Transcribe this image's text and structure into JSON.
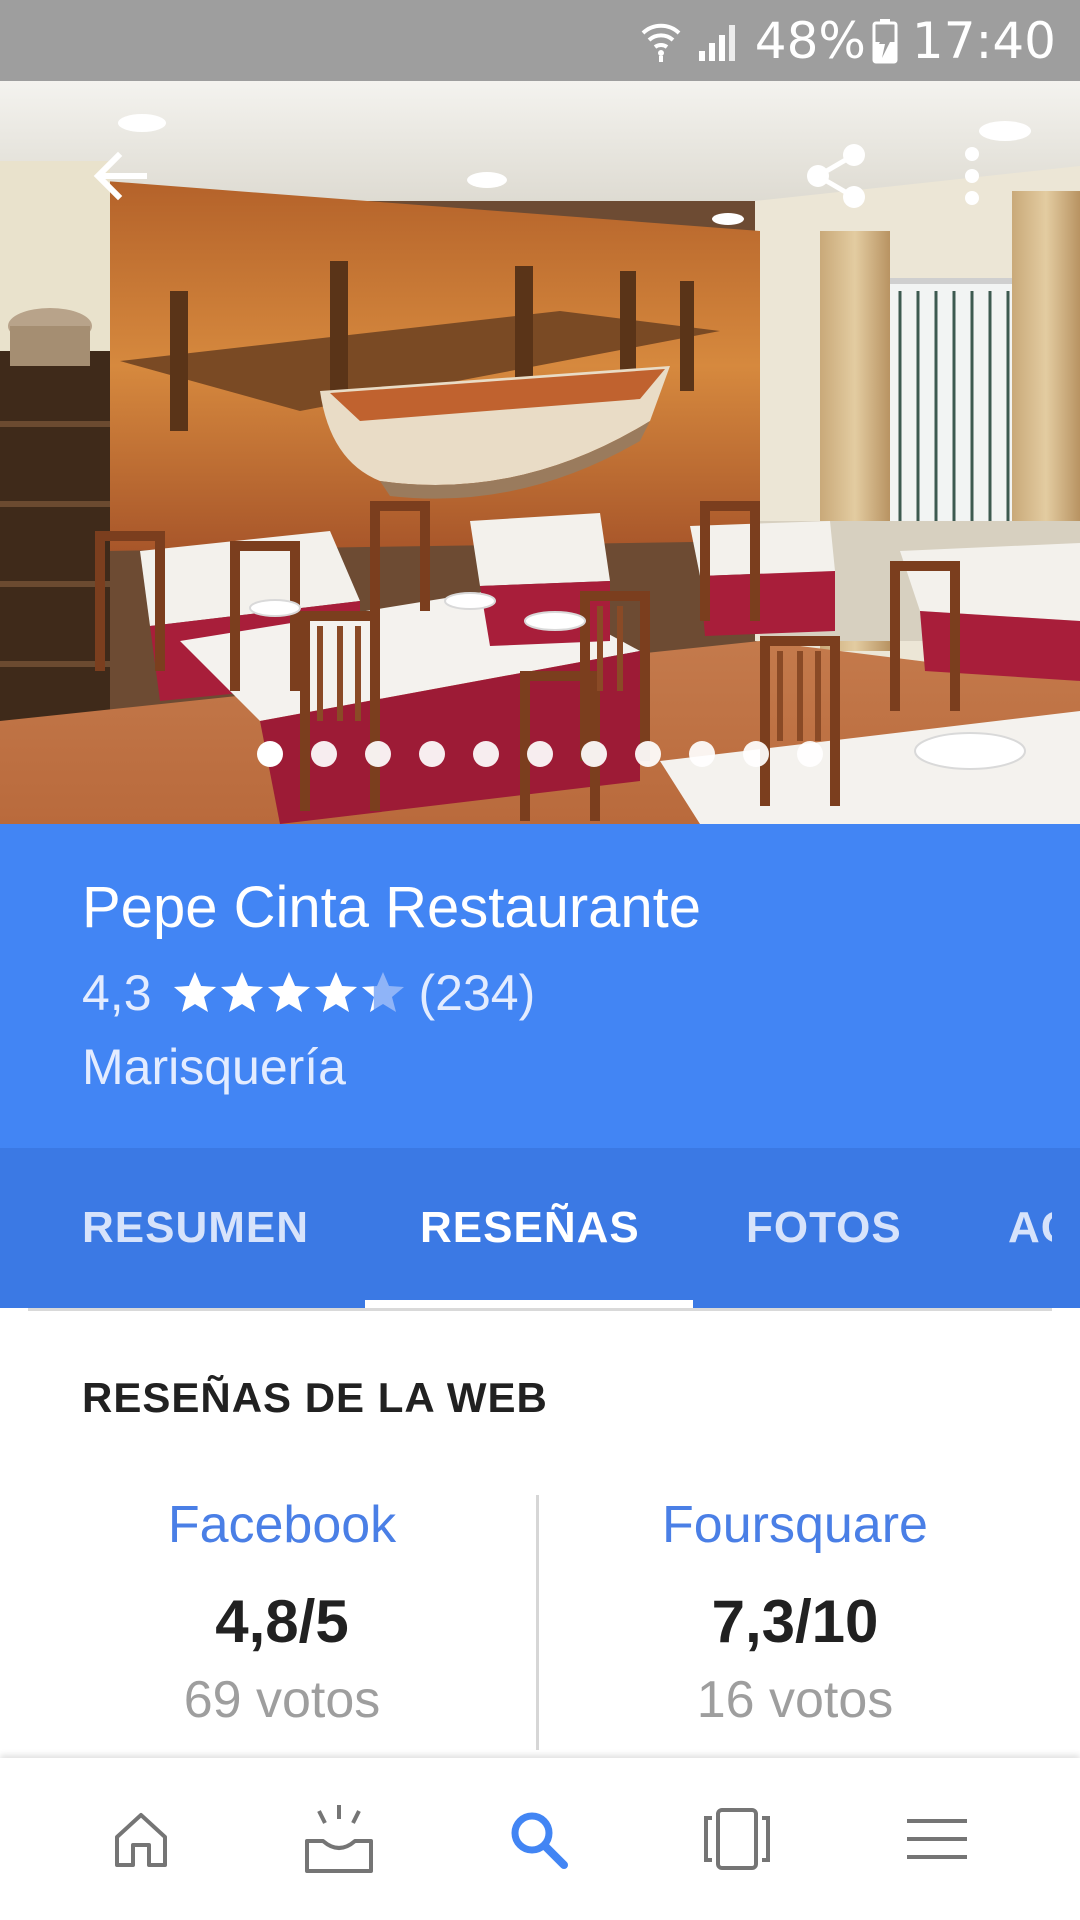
{
  "status_bar": {
    "battery": "48%",
    "time": "17:40",
    "icons": [
      "wifi-icon",
      "signal-icon",
      "battery-charging-icon"
    ]
  },
  "hero": {
    "photo_count": 11,
    "active_index": 0,
    "actions": [
      "back-arrow-icon",
      "share-icon",
      "more-vert-icon"
    ]
  },
  "place": {
    "name": "Pepe Cinta Restaurante",
    "rating": "4,3",
    "rating_value": 4.3,
    "review_count": "(234)",
    "category": "Marisquería"
  },
  "tabs": [
    {
      "label": "RESUMEN",
      "active": false
    },
    {
      "label": "RESEÑAS",
      "active": true
    },
    {
      "label": "FOTOS",
      "active": false
    },
    {
      "label": "AC",
      "active": false
    }
  ],
  "web_reviews": {
    "title": "RESEÑAS DE LA WEB",
    "sources": [
      {
        "name": "Facebook",
        "score": "4,8/5",
        "votes": "69 votos"
      },
      {
        "name": "Foursquare",
        "score": "7,3/10",
        "votes": "16 votos"
      }
    ]
  },
  "bottom_nav": {
    "items": [
      "home-icon",
      "inbox-icon",
      "search-icon",
      "pages-icon",
      "menu-icon"
    ],
    "active": "search-icon"
  },
  "colors": {
    "brand_blue": "#4285f4",
    "tab_blue": "#3b79e4",
    "link_blue": "#4a7fe6",
    "status_bar": "#9e9e9e"
  }
}
